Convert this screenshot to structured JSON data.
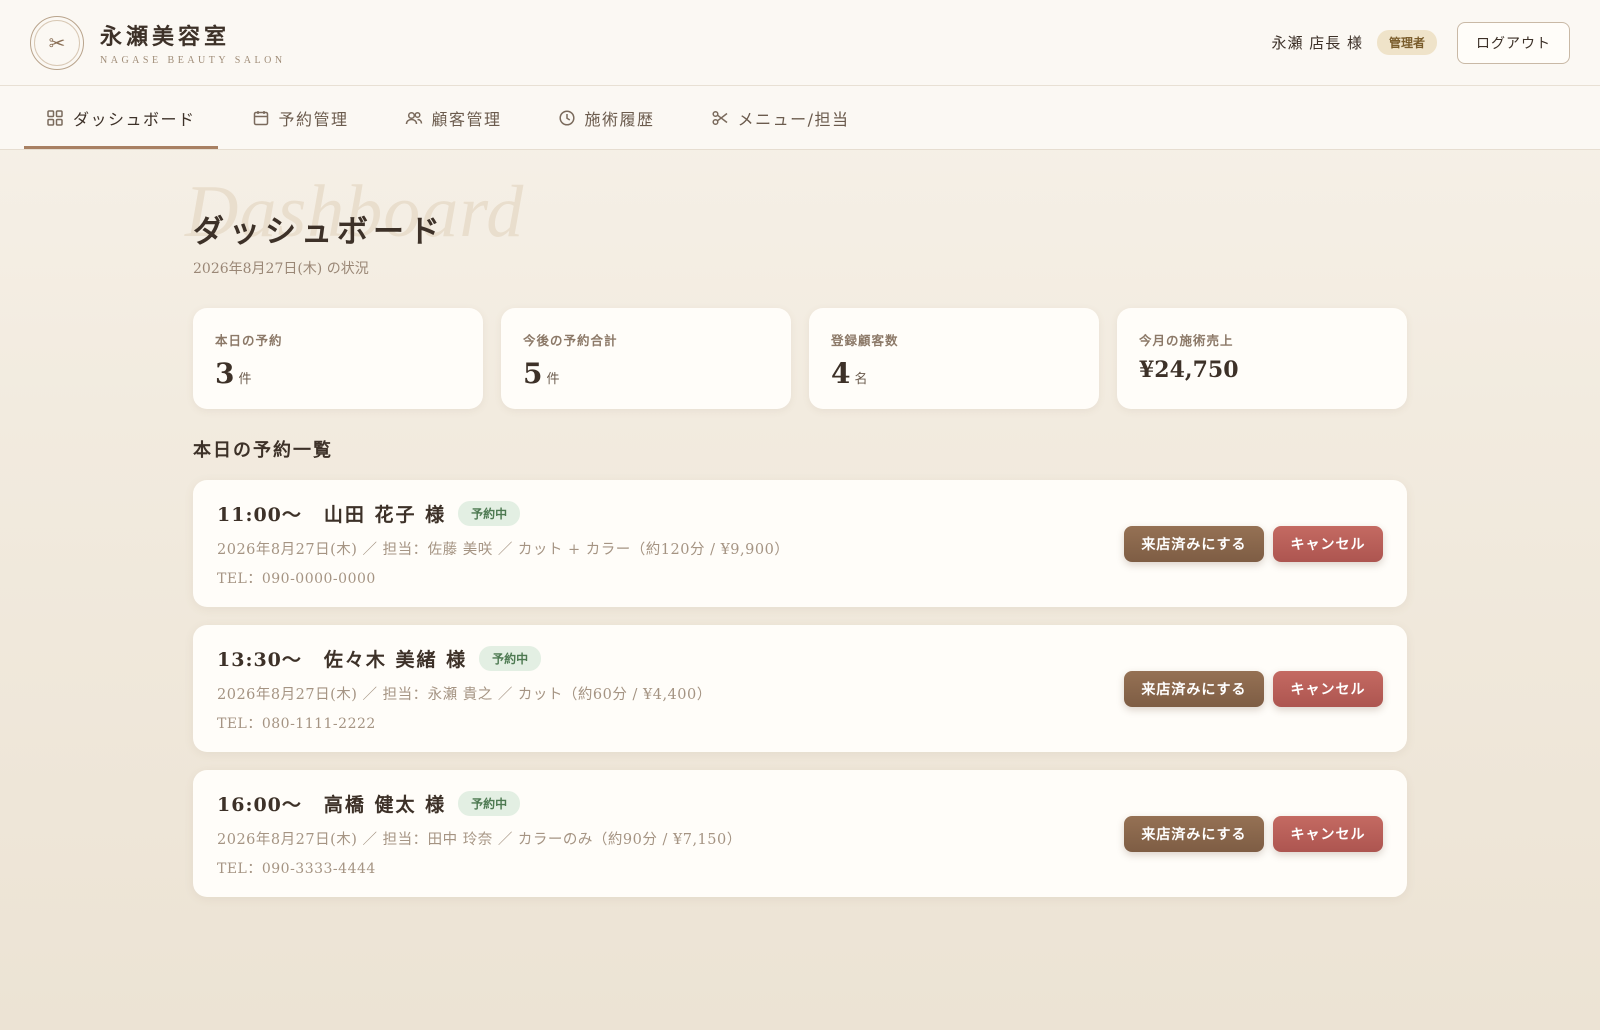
{
  "header": {
    "logo_glyph": "✂",
    "salon_name": "永瀬美容室",
    "salon_sub": "NAGASE BEAUTY SALON",
    "user_name": "永瀬 店長 様",
    "role": "管理者",
    "logout_label": "ログアウト"
  },
  "nav": {
    "tabs": [
      {
        "label": "ダッシュボード",
        "icon": "grid-icon",
        "active": true
      },
      {
        "label": "予約管理",
        "icon": "calendar-icon"
      },
      {
        "label": "顧客管理",
        "icon": "users-icon"
      },
      {
        "label": "施術履歴",
        "icon": "clock-icon"
      },
      {
        "label": "メニュー/担当",
        "icon": "scissors-icon"
      }
    ]
  },
  "page": {
    "watermark": "Dashboard",
    "title": "ダッシュボード",
    "subtitle": "2026年8月27日(木) の状況"
  },
  "stats": [
    {
      "label": "本日の予約",
      "value": "3",
      "unit": "件"
    },
    {
      "label": "今後の予約合計",
      "value": "5",
      "unit": "件"
    },
    {
      "label": "登録顧客数",
      "value": "4",
      "unit": "名"
    },
    {
      "label": "今月の施術売上",
      "value": "¥24,750",
      "unit": ""
    }
  ],
  "section_title": "本日の予約一覧",
  "appointments": [
    {
      "time": "11:00〜",
      "name": "山田 花子 様",
      "status": "予約中",
      "detail": "2026年8月27日(木) ／ 担当：佐藤 美咲 ／ カット + カラー（約120分 / ¥9,900）",
      "tel": "TEL：090-0000-0000",
      "visited_label": "来店済みにする",
      "cancel_label": "キャンセル"
    },
    {
      "time": "13:30〜",
      "name": "佐々木 美緒 様",
      "status": "予約中",
      "detail": "2026年8月27日(木) ／ 担当：永瀬 貴之 ／ カット（約60分 / ¥4,400）",
      "tel": "TEL：080-1111-2222",
      "visited_label": "来店済みにする",
      "cancel_label": "キャンセル"
    },
    {
      "time": "16:00〜",
      "name": "高橋 健太 様",
      "status": "予約中",
      "detail": "2026年8月27日(木) ／ 担当：田中 玲奈 ／ カラーのみ（約90分 / ¥7,150）",
      "tel": "TEL：090-3333-4444",
      "visited_label": "来店済みにする",
      "cancel_label": "キャンセル"
    }
  ],
  "colors": {
    "accent": "#a88062",
    "visited_button": "#8a6a4f",
    "cancel_button": "#b95e58",
    "status_badge": "#e3efe3"
  }
}
